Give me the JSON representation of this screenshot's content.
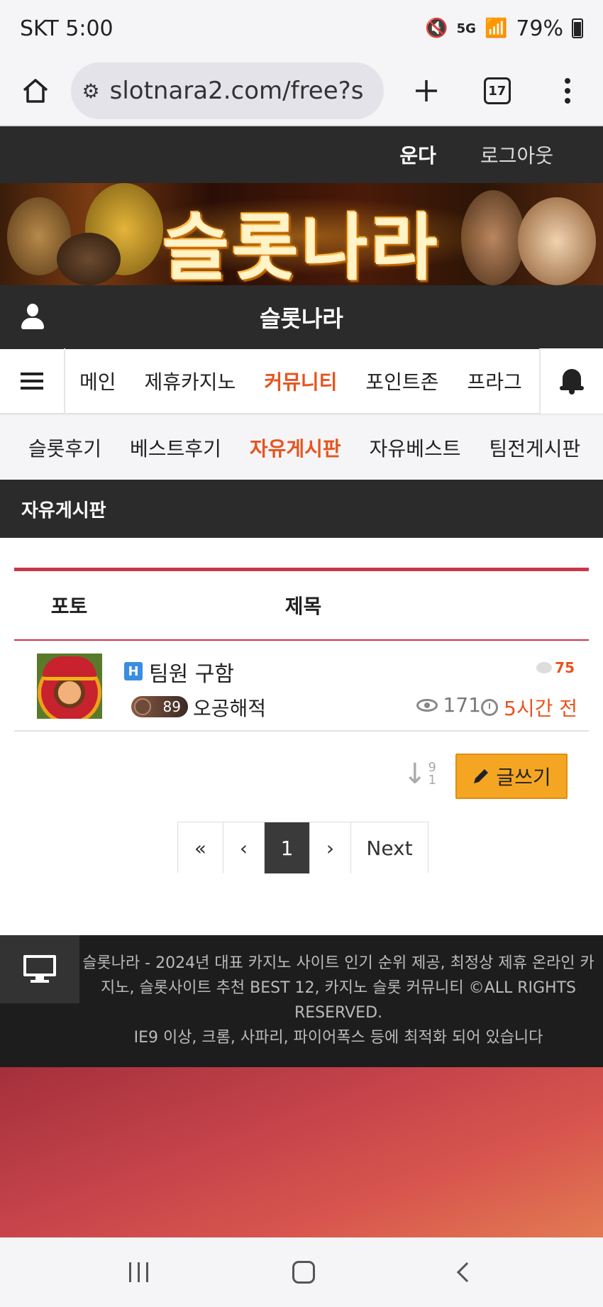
{
  "status": {
    "carrier_time": "SKT 5:00",
    "battery": "79%",
    "icons": [
      "mute-icon",
      "5g-icon",
      "signal-icon",
      "battery-icon"
    ]
  },
  "browser": {
    "url": "slotnara2.com/free?s",
    "tab_count": "17"
  },
  "site_top": {
    "user": "운다",
    "logout": "로그아웃"
  },
  "banner": {
    "title": "슬롯나라"
  },
  "header": {
    "site_name": "슬롯나라"
  },
  "main_nav": {
    "items": [
      "메인",
      "제휴카지노",
      "커뮤니티",
      "포인트존",
      "프라그"
    ],
    "active": "커뮤니티"
  },
  "sub_nav": {
    "items": [
      "슬롯후기",
      "베스트후기",
      "자유게시판",
      "자유베스트",
      "팀전게시판"
    ],
    "active": "자유게시판"
  },
  "board": {
    "title": "자유게시판",
    "columns": {
      "photo": "포토",
      "title": "제목"
    },
    "posts": [
      {
        "badge": "H",
        "title": "팀원 구함",
        "comments": "75",
        "level": "89",
        "author": "오공해적",
        "views": "171",
        "time": "5시간 전"
      }
    ],
    "sort_label": {
      "top": "9",
      "bottom": "1"
    },
    "write_button": "글쓰기"
  },
  "pagination": {
    "first": "«",
    "prev": "‹",
    "current": "1",
    "next": "›",
    "next_label": "Next"
  },
  "footer": {
    "line1": "슬롯나라 - 2024년 대표 카지노 사이트 인기 순위 제공, 최정상 제휴 온라인 카지노, 슬롯사이트 추천 BEST 12, 카지노 슬롯 커뮤니티 ©ALL RIGHTS RESERVED.",
    "line2": "IE9 이상, 크롬, 사파리, 파이어폭스 등에 최적화 되어 있습니다"
  },
  "colors": {
    "accent": "#e8541e",
    "dark_bar": "#2b2b2b",
    "table_line": "#c8374b",
    "write_button": "#f4a623"
  }
}
